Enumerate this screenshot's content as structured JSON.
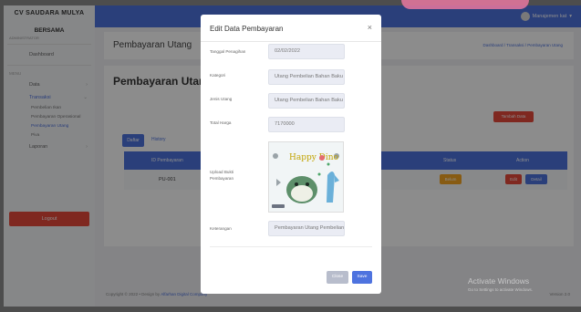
{
  "sidebar": {
    "brand_line1": "CV SAUDARA MULYA",
    "brand_line2": "BERSAMA",
    "brand_sub": "ADMINISTRATOR",
    "dashboard": "Dashboard",
    "section_label": "MENU",
    "data": "Data",
    "transaksi": "Transaksi",
    "sub_pembelian": "Pembelian Ikan",
    "sub_pembayaran_operasional": "Pembayaran Operasional",
    "sub_pembayaran_utang": "Pembayaran Utang",
    "sub_piva": "Piva",
    "laporan": "Laporan",
    "logout": "Logout"
  },
  "topbar": {
    "user_name": "Manajemen kat"
  },
  "page": {
    "header_title": "Pembayaran Utang",
    "breadcrumb": "Dashboard / Transaksi / Pembayaran Utang",
    "card_title": "Pembayaran Utan",
    "add_button": "Tambah Data",
    "tab_daftar": "Daftar",
    "tab_history": "History",
    "table_headers": [
      "ID Pembayaran",
      "Status",
      "Action"
    ],
    "row": {
      "id": "PU-001",
      "status": "Belum",
      "edit": "Edit",
      "detail": "Detail"
    }
  },
  "footer": {
    "copyright": "Copyright © 2022 • Design by",
    "link": "Alfarhan Digital Company",
    "version": "Version 2.0"
  },
  "watermark": {
    "title": "Activate Windows",
    "subtitle": "Go to Settings to activate Windows."
  },
  "modal": {
    "title": "Edit Data Pembayaran",
    "close_icon": "×",
    "fields": {
      "tanggal": {
        "label": "Tanggal Penagihan",
        "value": "02/02/2022"
      },
      "kategori": {
        "label": "Kategori",
        "value": "Utang Pembelian Bahan Baku"
      },
      "jenis": {
        "label": "Jenis Utang",
        "value": "Utang Pembelian Bahan Baku"
      },
      "total": {
        "label": "Total Harga",
        "value": "7170000"
      },
      "bukti": {
        "label_line1": "Upload Bukti",
        "label_line2": "Pembayaran",
        "image_text": "Happy Dino"
      },
      "keterangan": {
        "label": "Keterangan",
        "value": "Pembayaran Utang Pembelian"
      }
    },
    "buttons": {
      "close": "Close",
      "save": "Save"
    }
  },
  "colors": {
    "primary": "#4e73df",
    "danger": "#e74a3b",
    "warning": "#f6a623"
  }
}
